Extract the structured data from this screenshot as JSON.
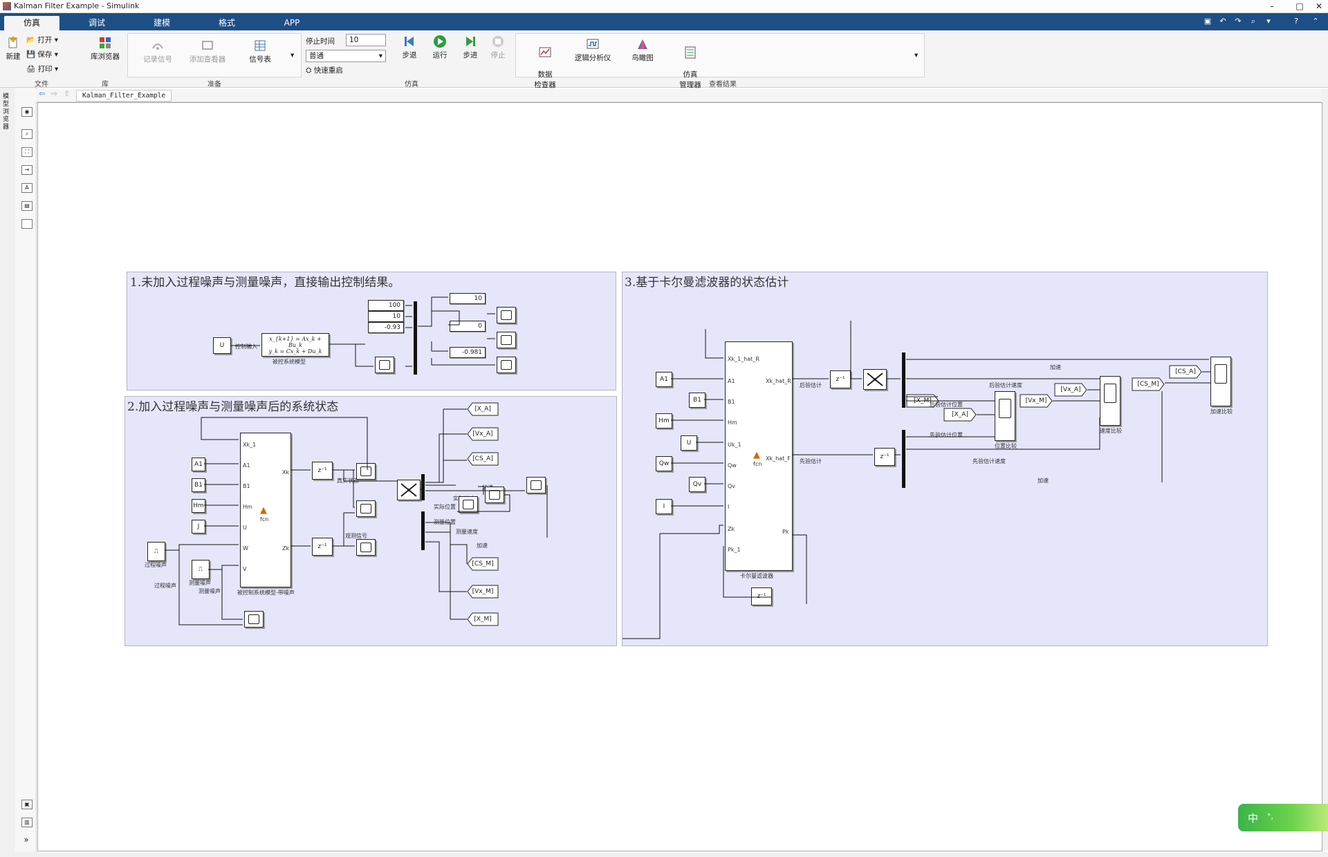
{
  "window": {
    "title": "Kalman Filter Example - Simulink",
    "minimize": "–",
    "maximize": "□",
    "close": "✕"
  },
  "tabs": [
    "仿真",
    "调试",
    "建模",
    "格式",
    "APP"
  ],
  "ribbon": {
    "file": {
      "new": "新建",
      "open": "打开",
      "save": "保存",
      "print": "打印",
      "group": "文件"
    },
    "library": {
      "browser": "库浏览器",
      "group": "库"
    },
    "prepare": {
      "log_signal": "记录信号",
      "add_viewer": "添加查看器",
      "signal_table": "信号表",
      "group": "准备"
    },
    "simulate": {
      "stop_time_label": "停止时间",
      "stop_time_value": "10",
      "mode": "普通",
      "fast_restart": "快速重启",
      "step_back": "步退",
      "run": "运行",
      "step_forward": "步进",
      "stop": "停止",
      "group": "仿真"
    },
    "review": {
      "data_inspector": "数据\n检查器",
      "logic_analyzer": "逻辑分析仪",
      "bird_view": "鸟瞰图",
      "sim_manager": "仿真\n管理器",
      "group": "查看结果"
    }
  },
  "left_strip": {
    "label": "模型浏览器"
  },
  "breadcrumb": "Kalman_Filter_Example",
  "areas": {
    "a1": {
      "title": "1.未加入过程噪声与测量噪声，直接输出控制结果。",
      "u": "U",
      "input_label": "控制输入",
      "ss_line1": "x_{k+1} = Ax_k + Bu_k",
      "ss_line2": "y_k = Cx_k + Du_k",
      "ss_label": "被控系统模型",
      "disp1": [
        "100",
        "10",
        "-0.93"
      ],
      "disp2": [
        "10",
        "0",
        "-0.981"
      ]
    },
    "a2": {
      "title": "2.加入过程噪声与测量噪声后的系统状态",
      "consts": [
        "A1",
        "B1",
        "Hm",
        "J"
      ],
      "ports_in": [
        "Xk_1",
        "A1",
        "B1",
        "Hm",
        "U",
        "W",
        "V"
      ],
      "port_xk": "Xk",
      "port_zk": "Zk",
      "fcn": "fcn",
      "model_label": "被控制系统模型-带噪声",
      "delay": "z⁻¹",
      "true_state": "真实状态",
      "meas_signal": "观测信号",
      "actual_pos": "实际位置",
      "actual_speed": "实际速度",
      "meas_pos": "测量位置",
      "meas_speed": "测量速度",
      "accel": "加速",
      "accel2": "加速",
      "proc_noise": "过程噪声",
      "meas_noise": "测量噪声",
      "proc_noise2": "过程噪声",
      "meas_noise2": "测量噪声",
      "tags": [
        "[X_A]",
        "[Vx_A]",
        "[CS_A]",
        "[CS_M]",
        "[Vx_M]",
        "[X_M]"
      ]
    },
    "a3": {
      "title": "3.基于卡尔曼滤波器的状态估计",
      "consts": [
        "A1",
        "B1",
        "Hm",
        "U",
        "Qw",
        "Qv",
        "I"
      ],
      "ports_in": [
        "Xk_1_hat_R",
        "A1",
        "B1",
        "Hm",
        "Uk_1",
        "Qw",
        "Qv",
        "I",
        "Zk",
        "Pk_1"
      ],
      "port_out1": "Xk_hat_R",
      "port_out2": "Xk_hat_F",
      "port_pk": "Pk",
      "fcn": "fcn",
      "kf_label": "卡尔曼滤波器",
      "delay": "z⁻¹",
      "post_est": "后验估计",
      "prior_est": "先验估计",
      "post_pos": "后验估计位置",
      "prior_pos": "先验估计位置",
      "pos_compare": "位置比较",
      "post_speed": "后验估计速度",
      "prior_speed": "先验估计速度",
      "speed_compare": "速度比较",
      "accel": "加速",
      "accel2": "加速",
      "accel_compare": "加速比较",
      "tags": [
        "[X_A]",
        "[X_M]",
        "[Vx_A]",
        "[Vx_M]",
        "[CS_A]",
        "[CS_M]"
      ]
    }
  },
  "ime": {
    "lang": "中",
    "punct": "°,"
  },
  "colors": {
    "tabbar": "#1e4e86",
    "area": "#e6e6fb",
    "ime": "#3ab54a"
  }
}
